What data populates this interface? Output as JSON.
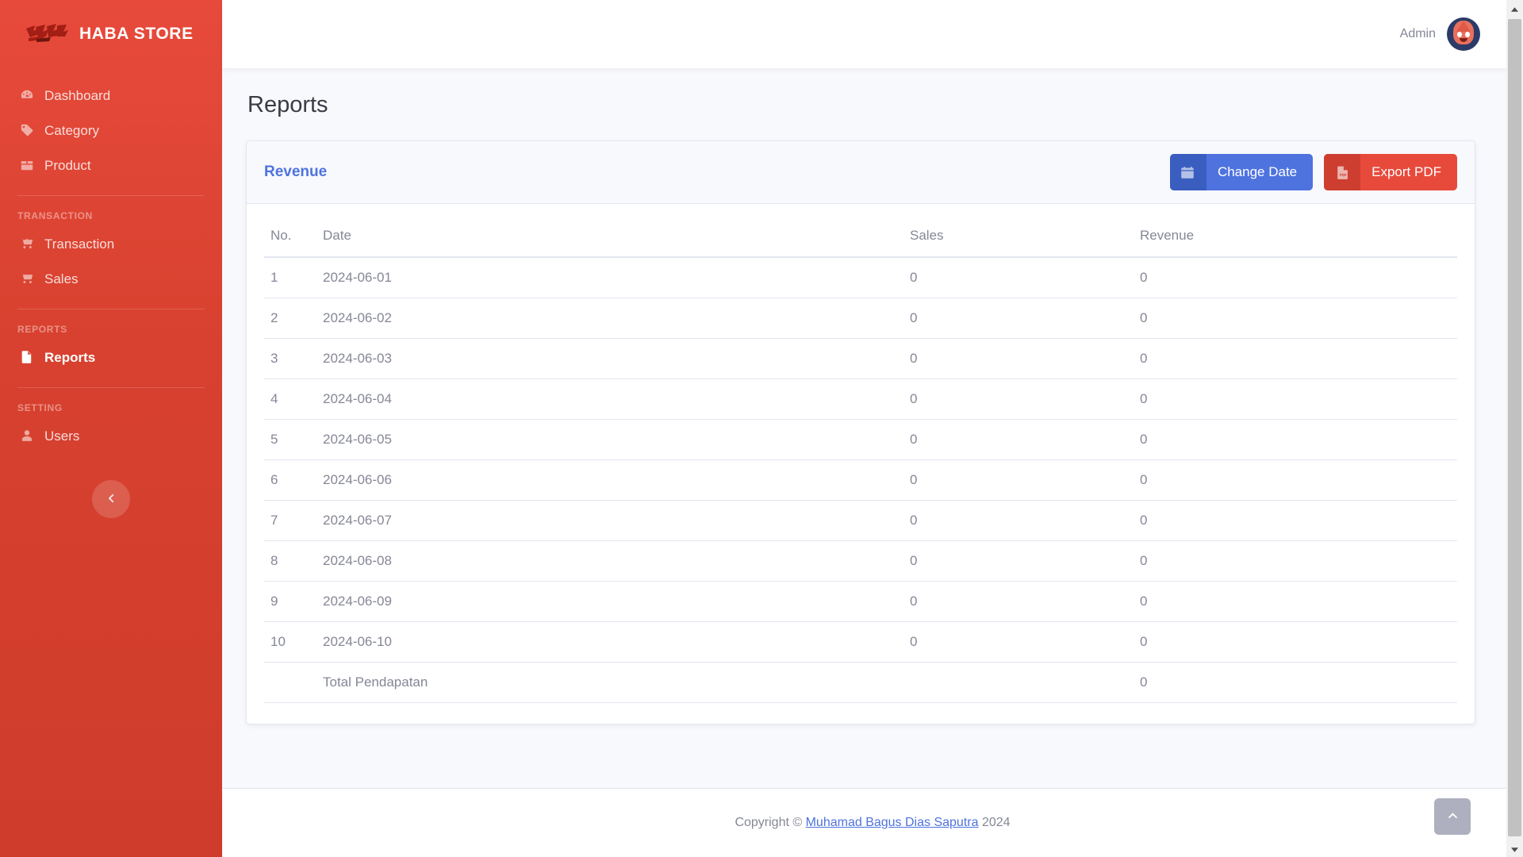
{
  "brand": {
    "name": "HABA STORE",
    "logo_icon": "haba-logo"
  },
  "sidebar": {
    "groups": [
      {
        "heading": null,
        "items": [
          {
            "label": "Dashboard",
            "icon": "gauge-icon",
            "active": false
          },
          {
            "label": "Category",
            "icon": "tag-icon",
            "active": false
          },
          {
            "label": "Product",
            "icon": "box-icon",
            "active": false
          }
        ]
      },
      {
        "heading": "TRANSACTION",
        "items": [
          {
            "label": "Transaction",
            "icon": "cart-plus-icon",
            "active": false
          },
          {
            "label": "Sales",
            "icon": "shopping-cart-icon",
            "active": false
          }
        ]
      },
      {
        "heading": "REPORTS",
        "items": [
          {
            "label": "Reports",
            "icon": "file-icon",
            "active": true
          }
        ]
      },
      {
        "heading": "SETTING",
        "items": [
          {
            "label": "Users",
            "icon": "user-icon",
            "active": false
          }
        ]
      }
    ],
    "collapse_icon": "chevron-left-icon"
  },
  "topbar": {
    "user_name": "Admin",
    "avatar_icon": "user-avatar"
  },
  "page": {
    "title": "Reports"
  },
  "card": {
    "title": "Revenue",
    "buttons": [
      {
        "label": "Change Date",
        "icon": "calendar-icon",
        "style": "primary"
      },
      {
        "label": "Export PDF",
        "icon": "file-pdf-icon",
        "style": "danger"
      }
    ]
  },
  "table": {
    "columns": [
      "No.",
      "Date",
      "Sales",
      "Revenue"
    ],
    "rows": [
      {
        "no": "1",
        "date": "2024-06-01",
        "sales": "0",
        "revenue": "0"
      },
      {
        "no": "2",
        "date": "2024-06-02",
        "sales": "0",
        "revenue": "0"
      },
      {
        "no": "3",
        "date": "2024-06-03",
        "sales": "0",
        "revenue": "0"
      },
      {
        "no": "4",
        "date": "2024-06-04",
        "sales": "0",
        "revenue": "0"
      },
      {
        "no": "5",
        "date": "2024-06-05",
        "sales": "0",
        "revenue": "0"
      },
      {
        "no": "6",
        "date": "2024-06-06",
        "sales": "0",
        "revenue": "0"
      },
      {
        "no": "7",
        "date": "2024-06-07",
        "sales": "0",
        "revenue": "0"
      },
      {
        "no": "8",
        "date": "2024-06-08",
        "sales": "0",
        "revenue": "0"
      },
      {
        "no": "9",
        "date": "2024-06-09",
        "sales": "0",
        "revenue": "0"
      },
      {
        "no": "10",
        "date": "2024-06-10",
        "sales": "0",
        "revenue": "0"
      }
    ],
    "total": {
      "no": "",
      "label": "Total Pendapatan",
      "sales": "",
      "revenue": "0"
    }
  },
  "footer": {
    "prefix": "Copyright © ",
    "link": "Muhamad Bagus Dias Saputra",
    "suffix": " 2024"
  },
  "scroll_top": {
    "icon": "chevron-up-icon"
  },
  "scrollbar": {
    "up_icon": "caret-up-icon",
    "down_icon": "caret-down-icon"
  },
  "colors": {
    "brand_red": "#e74a3b",
    "accent_blue": "#4e73df",
    "page_bg": "#f8f9fc",
    "text_muted": "#858796",
    "border": "#e3e6f0"
  }
}
